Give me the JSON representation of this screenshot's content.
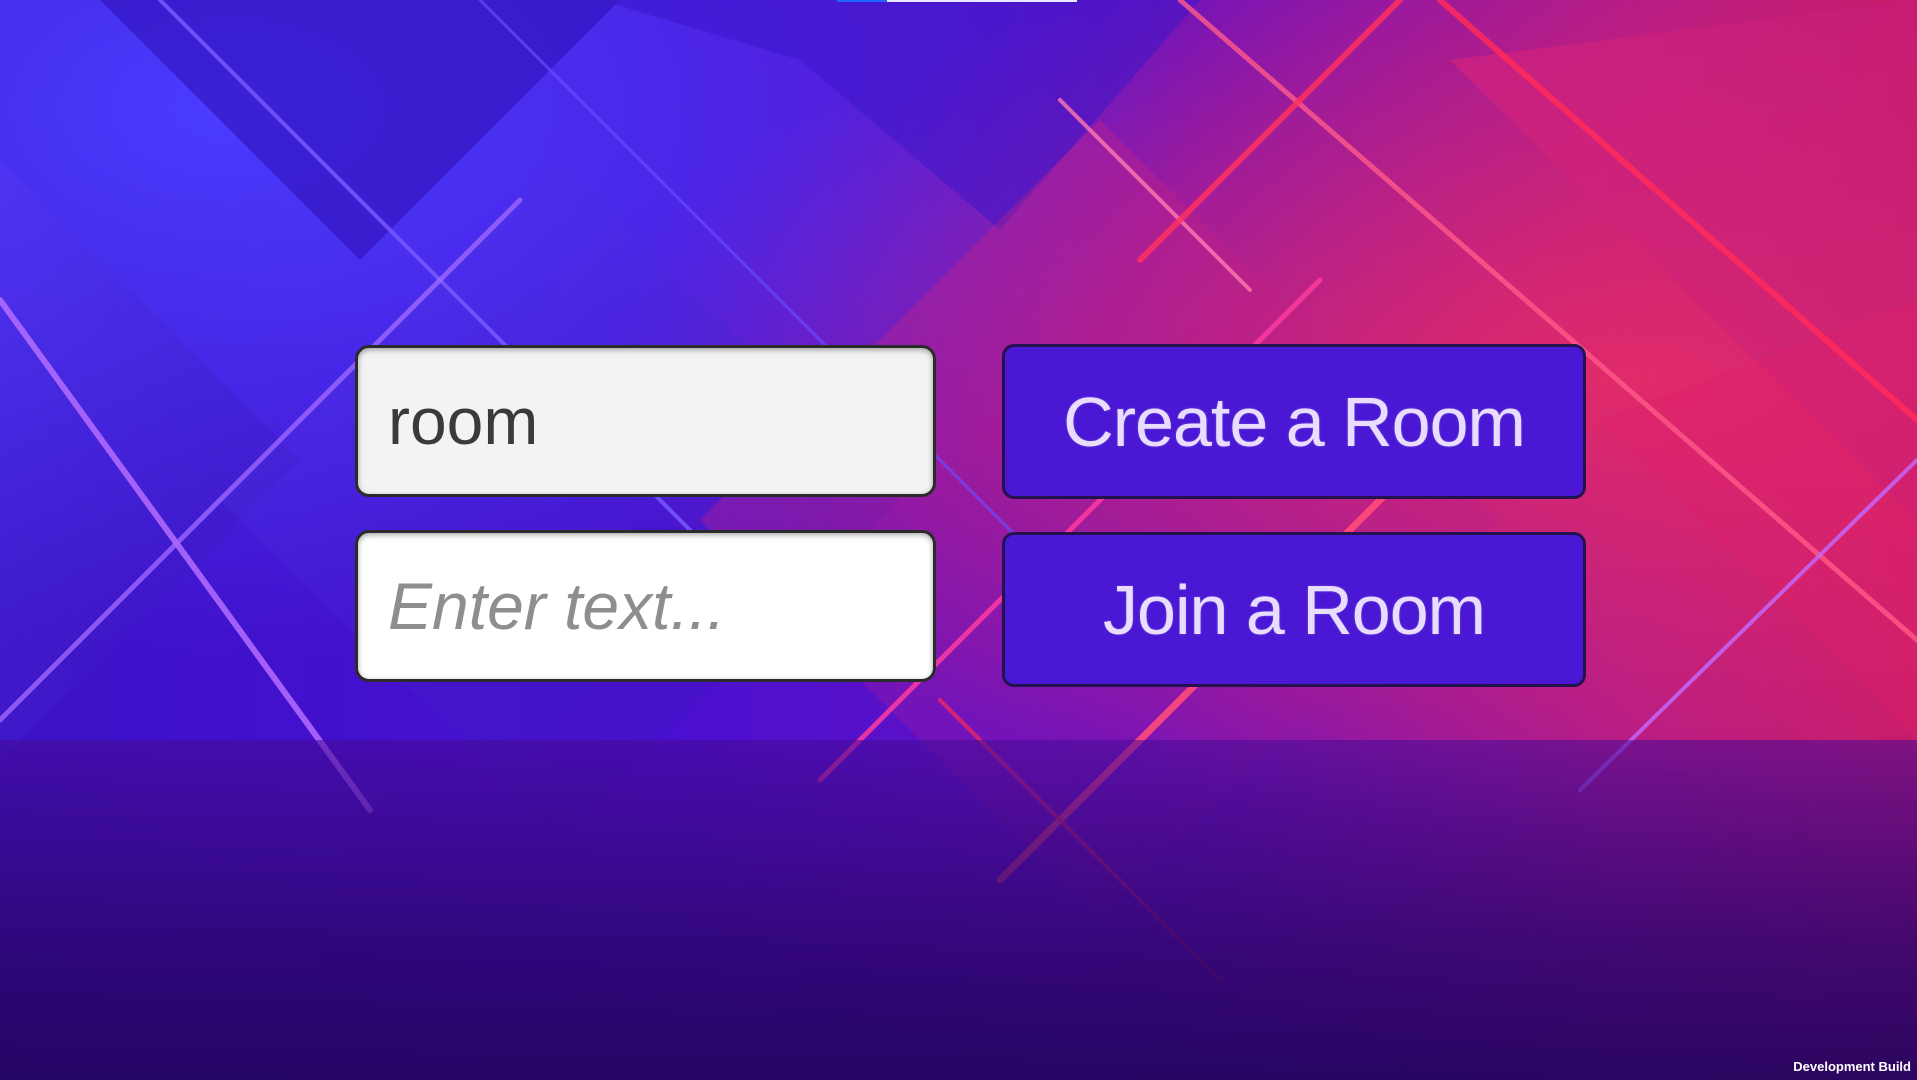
{
  "room_name_input": {
    "value": "room"
  },
  "text_input": {
    "placeholder": "Enter text..."
  },
  "buttons": {
    "create_label": "Create a Room",
    "join_label": "Join a Room"
  },
  "footer": {
    "build_label": "Development Build"
  },
  "colors": {
    "button_fill": "#4a17d4",
    "button_text": "#e8dcff",
    "background_accent_blue": "#3b12c8",
    "background_accent_pink": "#c41a6a"
  }
}
